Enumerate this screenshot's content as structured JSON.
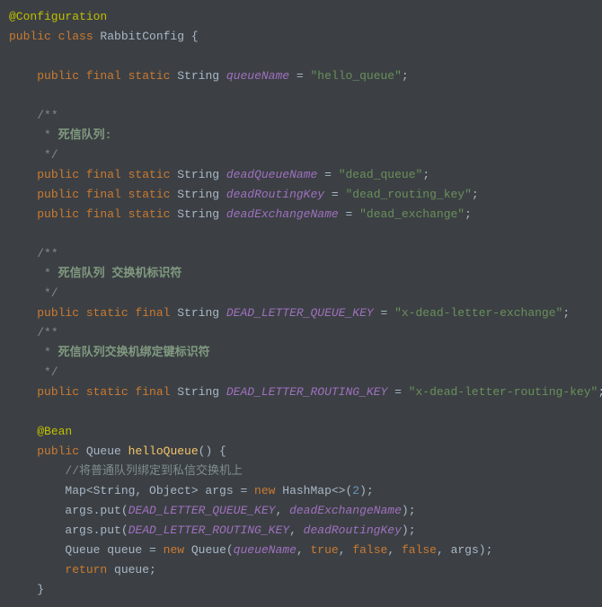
{
  "lines": [
    {
      "tokens": [
        {
          "t": "@Configuration",
          "c": "c-annotation"
        }
      ]
    },
    {
      "tokens": [
        {
          "t": "public class ",
          "c": "c-keyword"
        },
        {
          "t": "RabbitConfig ",
          "c": "c-class"
        },
        {
          "t": "{",
          "c": ""
        }
      ]
    },
    {
      "tokens": [
        {
          "t": "",
          "c": ""
        }
      ]
    },
    {
      "tokens": [
        {
          "t": "    ",
          "c": ""
        },
        {
          "t": "public final static ",
          "c": "c-keyword"
        },
        {
          "t": "String ",
          "c": "c-type"
        },
        {
          "t": "queueName",
          "c": "c-field"
        },
        {
          "t": " = ",
          "c": ""
        },
        {
          "t": "\"hello_queue\"",
          "c": "c-string"
        },
        {
          "t": ";",
          "c": ""
        }
      ]
    },
    {
      "tokens": [
        {
          "t": "",
          "c": ""
        }
      ]
    },
    {
      "tokens": [
        {
          "t": "    ",
          "c": ""
        },
        {
          "t": "/**",
          "c": "c-comment"
        }
      ]
    },
    {
      "tokens": [
        {
          "t": "     * ",
          "c": "c-comment"
        },
        {
          "t": "死信队列:",
          "c": "c-comment-bold"
        }
      ]
    },
    {
      "tokens": [
        {
          "t": "     */",
          "c": "c-comment"
        }
      ]
    },
    {
      "tokens": [
        {
          "t": "    ",
          "c": ""
        },
        {
          "t": "public final static ",
          "c": "c-keyword"
        },
        {
          "t": "String ",
          "c": "c-type"
        },
        {
          "t": "deadQueueName",
          "c": "c-field"
        },
        {
          "t": " = ",
          "c": ""
        },
        {
          "t": "\"dead_queue\"",
          "c": "c-string"
        },
        {
          "t": ";",
          "c": ""
        }
      ]
    },
    {
      "tokens": [
        {
          "t": "    ",
          "c": ""
        },
        {
          "t": "public final static ",
          "c": "c-keyword"
        },
        {
          "t": "String ",
          "c": "c-type"
        },
        {
          "t": "deadRoutingKey",
          "c": "c-field"
        },
        {
          "t": " = ",
          "c": ""
        },
        {
          "t": "\"dead_routing_key\"",
          "c": "c-string"
        },
        {
          "t": ";",
          "c": ""
        }
      ]
    },
    {
      "tokens": [
        {
          "t": "    ",
          "c": ""
        },
        {
          "t": "public final static ",
          "c": "c-keyword"
        },
        {
          "t": "String ",
          "c": "c-type"
        },
        {
          "t": "deadExchangeName",
          "c": "c-field"
        },
        {
          "t": " = ",
          "c": ""
        },
        {
          "t": "\"dead_exchange\"",
          "c": "c-string"
        },
        {
          "t": ";",
          "c": ""
        }
      ]
    },
    {
      "tokens": [
        {
          "t": "",
          "c": ""
        }
      ]
    },
    {
      "tokens": [
        {
          "t": "    ",
          "c": ""
        },
        {
          "t": "/**",
          "c": "c-comment"
        }
      ]
    },
    {
      "tokens": [
        {
          "t": "     * ",
          "c": "c-comment"
        },
        {
          "t": "死信队列 交换机标识符",
          "c": "c-comment-bold"
        }
      ]
    },
    {
      "tokens": [
        {
          "t": "     */",
          "c": "c-comment"
        }
      ]
    },
    {
      "tokens": [
        {
          "t": "    ",
          "c": ""
        },
        {
          "t": "public static final ",
          "c": "c-keyword"
        },
        {
          "t": "String ",
          "c": "c-type"
        },
        {
          "t": "DEAD_LETTER_QUEUE_KEY",
          "c": "c-field"
        },
        {
          "t": " = ",
          "c": ""
        },
        {
          "t": "\"x-dead-letter-exchange\"",
          "c": "c-string"
        },
        {
          "t": ";",
          "c": ""
        }
      ]
    },
    {
      "tokens": [
        {
          "t": "    ",
          "c": ""
        },
        {
          "t": "/**",
          "c": "c-comment"
        }
      ]
    },
    {
      "tokens": [
        {
          "t": "     * ",
          "c": "c-comment"
        },
        {
          "t": "死信队列交换机绑定键标识符",
          "c": "c-comment-bold"
        }
      ]
    },
    {
      "tokens": [
        {
          "t": "     */",
          "c": "c-comment"
        }
      ]
    },
    {
      "tokens": [
        {
          "t": "    ",
          "c": ""
        },
        {
          "t": "public static final ",
          "c": "c-keyword"
        },
        {
          "t": "String ",
          "c": "c-type"
        },
        {
          "t": "DEAD_LETTER_ROUTING_KEY",
          "c": "c-field"
        },
        {
          "t": " = ",
          "c": ""
        },
        {
          "t": "\"x-dead-letter-routing-key\"",
          "c": "c-string"
        },
        {
          "t": ";",
          "c": ""
        }
      ]
    },
    {
      "tokens": [
        {
          "t": "",
          "c": ""
        }
      ]
    },
    {
      "tokens": [
        {
          "t": "    ",
          "c": ""
        },
        {
          "t": "@Bean",
          "c": "c-annotation"
        }
      ]
    },
    {
      "tokens": [
        {
          "t": "    ",
          "c": ""
        },
        {
          "t": "public ",
          "c": "c-keyword"
        },
        {
          "t": "Queue ",
          "c": "c-type"
        },
        {
          "t": "helloQueue",
          "c": "c-method"
        },
        {
          "t": "() {",
          "c": ""
        }
      ]
    },
    {
      "tokens": [
        {
          "t": "        ",
          "c": ""
        },
        {
          "t": "//将普通队列绑定到私信交换机上",
          "c": "c-comment"
        }
      ]
    },
    {
      "tokens": [
        {
          "t": "        Map<String, Object> args = ",
          "c": ""
        },
        {
          "t": "new ",
          "c": "c-keyword"
        },
        {
          "t": "HashMap<>(",
          "c": ""
        },
        {
          "t": "2",
          "c": "c-number"
        },
        {
          "t": ");",
          "c": ""
        }
      ]
    },
    {
      "tokens": [
        {
          "t": "        args.put(",
          "c": ""
        },
        {
          "t": "DEAD_LETTER_QUEUE_KEY",
          "c": "c-field"
        },
        {
          "t": ", ",
          "c": ""
        },
        {
          "t": "deadExchangeName",
          "c": "c-field"
        },
        {
          "t": ");",
          "c": ""
        }
      ]
    },
    {
      "tokens": [
        {
          "t": "        args.put(",
          "c": ""
        },
        {
          "t": "DEAD_LETTER_ROUTING_KEY",
          "c": "c-field"
        },
        {
          "t": ", ",
          "c": ""
        },
        {
          "t": "deadRoutingKey",
          "c": "c-field"
        },
        {
          "t": ");",
          "c": ""
        }
      ]
    },
    {
      "tokens": [
        {
          "t": "        Queue queue = ",
          "c": ""
        },
        {
          "t": "new ",
          "c": "c-keyword"
        },
        {
          "t": "Queue(",
          "c": ""
        },
        {
          "t": "queueName",
          "c": "c-field"
        },
        {
          "t": ", ",
          "c": ""
        },
        {
          "t": "true",
          "c": "c-keyword"
        },
        {
          "t": ", ",
          "c": ""
        },
        {
          "t": "false",
          "c": "c-keyword"
        },
        {
          "t": ", ",
          "c": ""
        },
        {
          "t": "false",
          "c": "c-keyword"
        },
        {
          "t": ", args);",
          "c": ""
        }
      ]
    },
    {
      "tokens": [
        {
          "t": "        ",
          "c": ""
        },
        {
          "t": "return ",
          "c": "c-keyword"
        },
        {
          "t": "queue;",
          "c": ""
        }
      ]
    },
    {
      "tokens": [
        {
          "t": "    }",
          "c": ""
        }
      ]
    }
  ]
}
